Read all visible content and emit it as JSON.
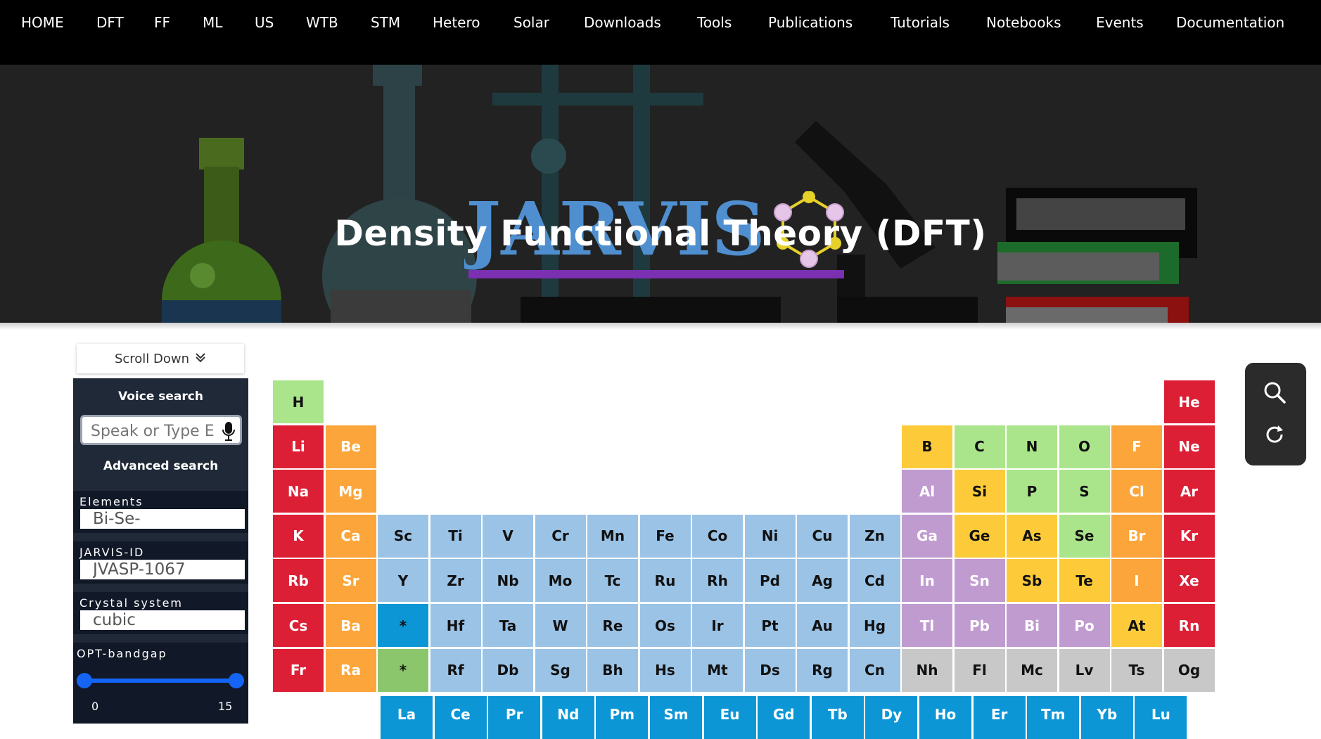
{
  "nav": {
    "items": [
      {
        "label": "HOME"
      },
      {
        "label": "DFT"
      },
      {
        "label": "FF"
      },
      {
        "label": "ML"
      },
      {
        "label": "US"
      },
      {
        "label": "WTB"
      },
      {
        "label": "STM"
      },
      {
        "label": "Hetero"
      },
      {
        "label": "Solar"
      },
      {
        "label": "Downloads"
      },
      {
        "label": "Tools"
      },
      {
        "label": "Publications"
      },
      {
        "label": "Tutorials"
      },
      {
        "label": "Notebooks"
      },
      {
        "label": "Events"
      },
      {
        "label": "Documentation"
      }
    ]
  },
  "hero": {
    "logo_text": "JARVIS",
    "title": "Density Functional Theory (DFT)"
  },
  "scroll_down": {
    "label": "Scroll Down",
    "icon": "double-chevron-down-icon"
  },
  "sidebar": {
    "voice_search_label": "Voice search",
    "voice_placeholder": "Speak or Type El",
    "advanced_search_label": "Advanced search",
    "elements": {
      "label": "Elements",
      "value": "Bi-Se-"
    },
    "jarvis_id": {
      "label": "JARVIS-ID",
      "value": "JVASP-1067"
    },
    "crystal_system": {
      "label": "Crystal system",
      "value": "cubic"
    },
    "opt_bandgap": {
      "label": "OPT-bandgap",
      "min": "0",
      "max": "15",
      "low": 0,
      "high": 15
    }
  },
  "tools": {
    "search_icon": "search-icon",
    "refresh_icon": "refresh-icon"
  },
  "colors": {
    "alkali": "#dc1f35",
    "alkaline": "#fba53a",
    "transition": "#9bc3e6",
    "post_transition": "#c09bd0",
    "metalloid": "#fdcb3a",
    "nonmetal": "#abe58b",
    "noble": "#dc1f35",
    "unknown": "#c8c8c8",
    "lanthanide": "#0c96d6",
    "actinide": "#8cc66c"
  },
  "periodic_table": {
    "rows": [
      [
        {
          "sym": "H",
          "g": 1,
          "cls": "nonmetal"
        },
        {
          "sym": "He",
          "g": 18,
          "cls": "noble"
        }
      ],
      [
        {
          "sym": "Li",
          "g": 1,
          "cls": "alkali"
        },
        {
          "sym": "Be",
          "g": 2,
          "cls": "alkaline"
        },
        {
          "sym": "B",
          "g": 13,
          "cls": "metalloid"
        },
        {
          "sym": "C",
          "g": 14,
          "cls": "nonmetal"
        },
        {
          "sym": "N",
          "g": 15,
          "cls": "nonmetal"
        },
        {
          "sym": "O",
          "g": 16,
          "cls": "nonmetal"
        },
        {
          "sym": "F",
          "g": 17,
          "cls": "alkaline"
        },
        {
          "sym": "Ne",
          "g": 18,
          "cls": "noble"
        }
      ],
      [
        {
          "sym": "Na",
          "g": 1,
          "cls": "alkali"
        },
        {
          "sym": "Mg",
          "g": 2,
          "cls": "alkaline"
        },
        {
          "sym": "Al",
          "g": 13,
          "cls": "post_transition"
        },
        {
          "sym": "Si",
          "g": 14,
          "cls": "metalloid"
        },
        {
          "sym": "P",
          "g": 15,
          "cls": "nonmetal"
        },
        {
          "sym": "S",
          "g": 16,
          "cls": "nonmetal"
        },
        {
          "sym": "Cl",
          "g": 17,
          "cls": "alkaline"
        },
        {
          "sym": "Ar",
          "g": 18,
          "cls": "noble"
        }
      ],
      [
        {
          "sym": "K",
          "g": 1,
          "cls": "alkali"
        },
        {
          "sym": "Ca",
          "g": 2,
          "cls": "alkaline"
        },
        {
          "sym": "Sc",
          "g": 3,
          "cls": "transition"
        },
        {
          "sym": "Ti",
          "g": 4,
          "cls": "transition"
        },
        {
          "sym": "V",
          "g": 5,
          "cls": "transition"
        },
        {
          "sym": "Cr",
          "g": 6,
          "cls": "transition"
        },
        {
          "sym": "Mn",
          "g": 7,
          "cls": "transition"
        },
        {
          "sym": "Fe",
          "g": 8,
          "cls": "transition"
        },
        {
          "sym": "Co",
          "g": 9,
          "cls": "transition"
        },
        {
          "sym": "Ni",
          "g": 10,
          "cls": "transition"
        },
        {
          "sym": "Cu",
          "g": 11,
          "cls": "transition"
        },
        {
          "sym": "Zn",
          "g": 12,
          "cls": "transition"
        },
        {
          "sym": "Ga",
          "g": 13,
          "cls": "post_transition"
        },
        {
          "sym": "Ge",
          "g": 14,
          "cls": "metalloid"
        },
        {
          "sym": "As",
          "g": 15,
          "cls": "metalloid"
        },
        {
          "sym": "Se",
          "g": 16,
          "cls": "nonmetal"
        },
        {
          "sym": "Br",
          "g": 17,
          "cls": "alkaline"
        },
        {
          "sym": "Kr",
          "g": 18,
          "cls": "noble"
        }
      ],
      [
        {
          "sym": "Rb",
          "g": 1,
          "cls": "alkali"
        },
        {
          "sym": "Sr",
          "g": 2,
          "cls": "alkaline"
        },
        {
          "sym": "Y",
          "g": 3,
          "cls": "transition"
        },
        {
          "sym": "Zr",
          "g": 4,
          "cls": "transition"
        },
        {
          "sym": "Nb",
          "g": 5,
          "cls": "transition"
        },
        {
          "sym": "Mo",
          "g": 6,
          "cls": "transition"
        },
        {
          "sym": "Tc",
          "g": 7,
          "cls": "transition"
        },
        {
          "sym": "Ru",
          "g": 8,
          "cls": "transition"
        },
        {
          "sym": "Rh",
          "g": 9,
          "cls": "transition"
        },
        {
          "sym": "Pd",
          "g": 10,
          "cls": "transition"
        },
        {
          "sym": "Ag",
          "g": 11,
          "cls": "transition"
        },
        {
          "sym": "Cd",
          "g": 12,
          "cls": "transition"
        },
        {
          "sym": "In",
          "g": 13,
          "cls": "post_transition"
        },
        {
          "sym": "Sn",
          "g": 14,
          "cls": "post_transition"
        },
        {
          "sym": "Sb",
          "g": 15,
          "cls": "metalloid"
        },
        {
          "sym": "Te",
          "g": 16,
          "cls": "metalloid"
        },
        {
          "sym": "I",
          "g": 17,
          "cls": "alkaline"
        },
        {
          "sym": "Xe",
          "g": 18,
          "cls": "noble"
        }
      ],
      [
        {
          "sym": "Cs",
          "g": 1,
          "cls": "alkali"
        },
        {
          "sym": "Ba",
          "g": 2,
          "cls": "alkaline"
        },
        {
          "sym": "*",
          "g": 3,
          "cls": "lanthanide"
        },
        {
          "sym": "Hf",
          "g": 4,
          "cls": "transition"
        },
        {
          "sym": "Ta",
          "g": 5,
          "cls": "transition"
        },
        {
          "sym": "W",
          "g": 6,
          "cls": "transition"
        },
        {
          "sym": "Re",
          "g": 7,
          "cls": "transition"
        },
        {
          "sym": "Os",
          "g": 8,
          "cls": "transition"
        },
        {
          "sym": "Ir",
          "g": 9,
          "cls": "transition"
        },
        {
          "sym": "Pt",
          "g": 10,
          "cls": "transition"
        },
        {
          "sym": "Au",
          "g": 11,
          "cls": "transition"
        },
        {
          "sym": "Hg",
          "g": 12,
          "cls": "transition"
        },
        {
          "sym": "Tl",
          "g": 13,
          "cls": "post_transition"
        },
        {
          "sym": "Pb",
          "g": 14,
          "cls": "post_transition"
        },
        {
          "sym": "Bi",
          "g": 15,
          "cls": "post_transition"
        },
        {
          "sym": "Po",
          "g": 16,
          "cls": "post_transition"
        },
        {
          "sym": "At",
          "g": 17,
          "cls": "metalloid"
        },
        {
          "sym": "Rn",
          "g": 18,
          "cls": "noble"
        }
      ],
      [
        {
          "sym": "Fr",
          "g": 1,
          "cls": "alkali"
        },
        {
          "sym": "Ra",
          "g": 2,
          "cls": "alkaline"
        },
        {
          "sym": "*",
          "g": 3,
          "cls": "actinide"
        },
        {
          "sym": "Rf",
          "g": 4,
          "cls": "transition"
        },
        {
          "sym": "Db",
          "g": 5,
          "cls": "transition"
        },
        {
          "sym": "Sg",
          "g": 6,
          "cls": "transition"
        },
        {
          "sym": "Bh",
          "g": 7,
          "cls": "transition"
        },
        {
          "sym": "Hs",
          "g": 8,
          "cls": "transition"
        },
        {
          "sym": "Mt",
          "g": 9,
          "cls": "transition"
        },
        {
          "sym": "Ds",
          "g": 10,
          "cls": "transition"
        },
        {
          "sym": "Rg",
          "g": 11,
          "cls": "transition"
        },
        {
          "sym": "Cn",
          "g": 12,
          "cls": "transition"
        },
        {
          "sym": "Nh",
          "g": 13,
          "cls": "unknown"
        },
        {
          "sym": "Fl",
          "g": 14,
          "cls": "unknown"
        },
        {
          "sym": "Mc",
          "g": 15,
          "cls": "unknown"
        },
        {
          "sym": "Lv",
          "g": 16,
          "cls": "unknown"
        },
        {
          "sym": "Ts",
          "g": 17,
          "cls": "unknown"
        },
        {
          "sym": "Og",
          "g": 18,
          "cls": "unknown"
        }
      ]
    ],
    "lanthanides": [
      "La",
      "Ce",
      "Pr",
      "Nd",
      "Pm",
      "Sm",
      "Eu",
      "Gd",
      "Tb",
      "Dy",
      "Ho",
      "Er",
      "Tm",
      "Yb",
      "Lu"
    ]
  }
}
